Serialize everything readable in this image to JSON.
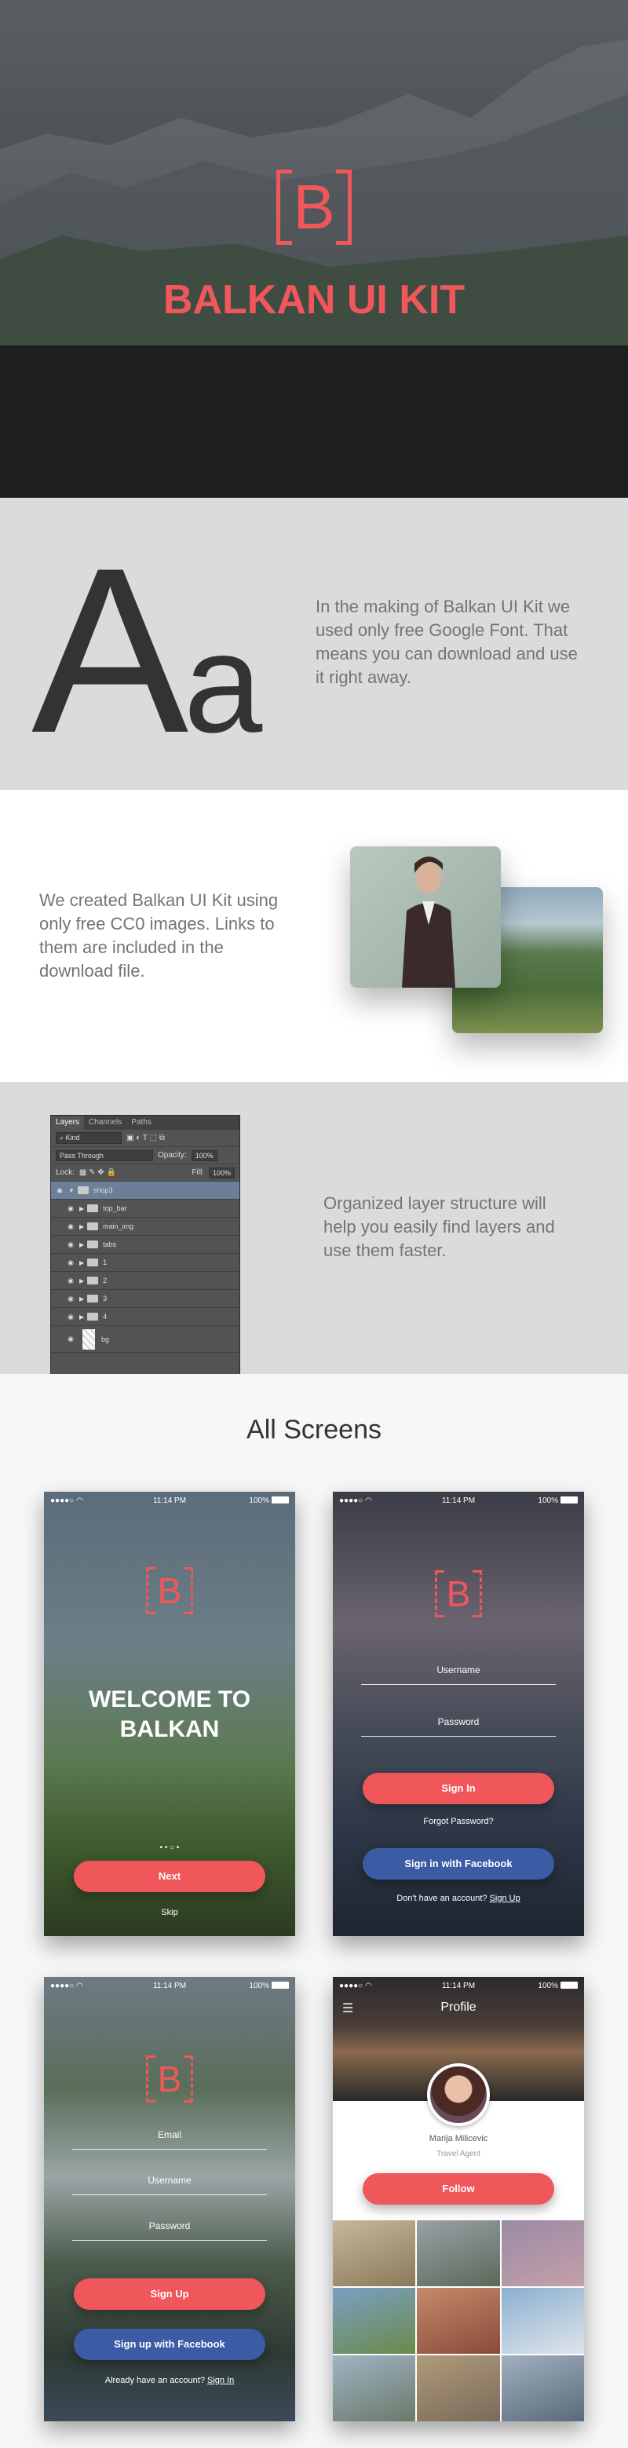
{
  "hero": {
    "logo_letter": "B",
    "title": "BALKAN UI KIT"
  },
  "typography": {
    "sample": "A",
    "sample_small": "a",
    "text": "In the making of Balkan UI Kit we used only free Google Font. That means you can download and use it right away."
  },
  "photos": {
    "text": "We created Balkan UI Kit using only free CC0 images. Links to them are included in the download file."
  },
  "layers": {
    "text": "Organized layer structure will help you easily find layers and use them faster.",
    "tabs": [
      "Layers",
      "Channels",
      "Paths"
    ],
    "kind_label": "Kind",
    "blend_mode": "Pass Through",
    "opacity_label": "Opacity:",
    "opacity_value": "100%",
    "lock_label": "Lock:",
    "fill_label": "Fill:",
    "fill_value": "100%",
    "items": [
      "shop3",
      "top_bar",
      "main_img",
      "tabs",
      "1",
      "2",
      "3",
      "4",
      "bg"
    ]
  },
  "screens": {
    "heading": "All Screens",
    "status": {
      "time": "11:14 PM",
      "battery": "100%"
    },
    "welcome": {
      "title_line1": "WELCOME TO",
      "title_line2": "BALKAN",
      "pager": "• • ○ •",
      "next": "Next",
      "skip": "Skip"
    },
    "signin": {
      "username": "Username",
      "password": "Password",
      "sign_in": "Sign In",
      "forgot": "Forgot Password?",
      "facebook": "Sign in with Facebook",
      "no_account": "Don't have an account?",
      "sign_up_link": "Sign Up"
    },
    "signup": {
      "email": "Email",
      "username": "Username",
      "password": "Password",
      "sign_up": "Sign Up",
      "facebook": "Sign up with Facebook",
      "have_account": "Already have an account?",
      "sign_in_link": "Sign In"
    },
    "profile": {
      "title": "Profile",
      "name": "Marija Milicevic",
      "role": "Travel Agent",
      "follow": "Follow"
    }
  },
  "colors": {
    "accent": "#f0575b",
    "facebook": "#3b5ba4",
    "panel": "#535353"
  }
}
